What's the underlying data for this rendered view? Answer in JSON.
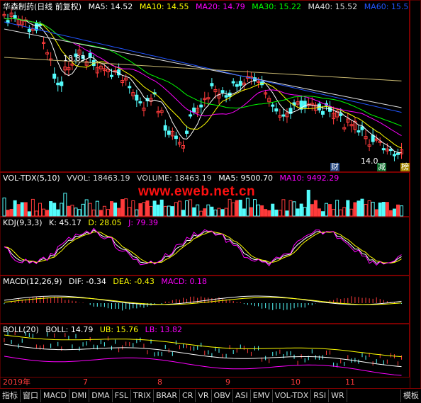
{
  "title": "华森制药(日线 前复权)",
  "price_indicators": [
    {
      "label": "MA5: 14.52",
      "color": "#ffffff"
    },
    {
      "label": "MA10: 14.55",
      "color": "#ffff00"
    },
    {
      "label": "MA20: 14.79",
      "color": "#ff00ff"
    },
    {
      "label": "MA30: 15.22",
      "color": "#00ff00"
    },
    {
      "label": "MA40: 15.52",
      "color": "#dddddd"
    },
    {
      "label": "MA60: 15.5",
      "color": "#2255ff"
    }
  ],
  "price_annotations": {
    "high": "18.83",
    "low": "14.0",
    "badge_cai": "财",
    "badge_jian": "减",
    "badge_bang": "榜"
  },
  "vol_panel": {
    "name": "VOL-TDX(5,10)",
    "indicators": [
      {
        "label": "VVOL: 18463.19",
        "color": "#dddddd"
      },
      {
        "label": "VOLUME: 18463.19",
        "color": "#dddddd"
      },
      {
        "label": "MA5: 9500.70",
        "color": "#ffffff"
      },
      {
        "label": "MA10: 9492.29",
        "color": "#ff00ff"
      }
    ]
  },
  "kdj_panel": {
    "name": "KDJ(9,3,3)",
    "indicators": [
      {
        "label": "K: 45.17",
        "color": "#ffffff"
      },
      {
        "label": "D: 28.05",
        "color": "#ffff00"
      },
      {
        "label": "J: 79.39",
        "color": "#ff00ff"
      }
    ]
  },
  "macd_panel": {
    "name": "MACD(12,26,9)",
    "indicators": [
      {
        "label": "DIF: -0.34",
        "color": "#ffffff"
      },
      {
        "label": "DEA: -0.43",
        "color": "#ffff00"
      },
      {
        "label": "MACD: 0.18",
        "color": "#ff00ff"
      }
    ]
  },
  "boll_panel": {
    "name": "BOLL(20)",
    "indicators": [
      {
        "label": "BOLL: 14.79",
        "color": "#ffffff"
      },
      {
        "label": "UB: 15.76",
        "color": "#ffff00"
      },
      {
        "label": "LB: 13.82",
        "color": "#ff00ff"
      }
    ]
  },
  "watermark": "www.eweb.net.cn",
  "x_axis": {
    "labels": [
      "2019年",
      "7",
      "8",
      "9",
      "10",
      "11"
    ]
  },
  "tabs": [
    "指标",
    "窗口",
    "MACD",
    "DMI",
    "DMA",
    "FSL",
    "TRIX",
    "BRAR",
    "CR",
    "VR",
    "OBV",
    "ASI",
    "EMV",
    "VOL-TDX",
    "RSI",
    "WR",
    "模板"
  ],
  "colors": {
    "up": "#ff3b3b",
    "down": "#54fcfc",
    "border": "#7a0000"
  }
}
